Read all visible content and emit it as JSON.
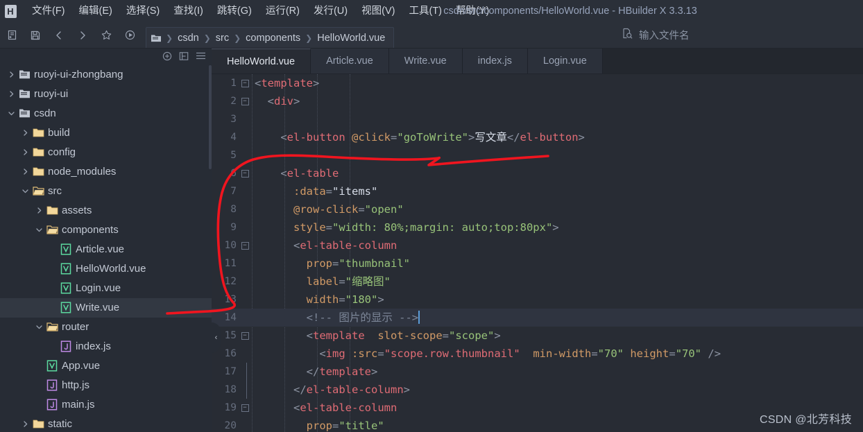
{
  "window": {
    "title": "csdn/src/components/HelloWorld.vue - HBuilder X 3.3.13",
    "logo_letter": "H"
  },
  "menubar": {
    "items": [
      {
        "label": "文件(F)",
        "name": "menu-file"
      },
      {
        "label": "编辑(E)",
        "name": "menu-edit"
      },
      {
        "label": "选择(S)",
        "name": "menu-select"
      },
      {
        "label": "查找(I)",
        "name": "menu-find"
      },
      {
        "label": "跳转(G)",
        "name": "menu-goto"
      },
      {
        "label": "运行(R)",
        "name": "menu-run"
      },
      {
        "label": "发行(U)",
        "name": "menu-publish"
      },
      {
        "label": "视图(V)",
        "name": "menu-view"
      },
      {
        "label": "工具(T)",
        "name": "menu-tools"
      },
      {
        "label": "帮助(Y)",
        "name": "menu-help"
      }
    ]
  },
  "toolbar": {
    "icons": [
      {
        "name": "new-file-icon"
      },
      {
        "name": "save-icon"
      },
      {
        "name": "back-arrow-icon"
      },
      {
        "name": "forward-arrow-icon"
      },
      {
        "name": "star-icon"
      },
      {
        "name": "run-icon"
      }
    ],
    "breadcrumb": [
      "csdn",
      "src",
      "components",
      "HelloWorld.vue"
    ],
    "file_search_placeholder": "输入文件名"
  },
  "sidebar": {
    "header_icons": [
      {
        "name": "add-project-icon"
      },
      {
        "name": "collapse-all-icon"
      },
      {
        "name": "menu-hamburger-icon"
      }
    ],
    "tree": [
      {
        "label": "ruoyi-ui-zhongbang",
        "indent": 0,
        "chev": "right",
        "icon": "project-icon",
        "selected": false
      },
      {
        "label": "ruoyi-ui",
        "indent": 0,
        "chev": "right",
        "icon": "project-icon",
        "selected": false
      },
      {
        "label": "csdn",
        "indent": 0,
        "chev": "down",
        "icon": "project-icon",
        "selected": false
      },
      {
        "label": "build",
        "indent": 1,
        "chev": "right",
        "icon": "folder-icon",
        "selected": false
      },
      {
        "label": "config",
        "indent": 1,
        "chev": "right",
        "icon": "folder-icon",
        "selected": false
      },
      {
        "label": "node_modules",
        "indent": 1,
        "chev": "right",
        "icon": "folder-icon",
        "selected": false
      },
      {
        "label": "src",
        "indent": 1,
        "chev": "down",
        "icon": "folder-open-icon",
        "selected": false
      },
      {
        "label": "assets",
        "indent": 2,
        "chev": "right",
        "icon": "folder-icon",
        "selected": false
      },
      {
        "label": "components",
        "indent": 2,
        "chev": "down",
        "icon": "folder-open-icon",
        "selected": false
      },
      {
        "label": "Article.vue",
        "indent": 3,
        "chev": "none",
        "icon": "vue-file-icon",
        "selected": false
      },
      {
        "label": "HelloWorld.vue",
        "indent": 3,
        "chev": "none",
        "icon": "vue-file-icon",
        "selected": false
      },
      {
        "label": "Login.vue",
        "indent": 3,
        "chev": "none",
        "icon": "vue-file-icon",
        "selected": false
      },
      {
        "label": "Write.vue",
        "indent": 3,
        "chev": "none",
        "icon": "vue-file-icon",
        "selected": true
      },
      {
        "label": "router",
        "indent": 2,
        "chev": "down",
        "icon": "folder-open-icon",
        "selected": false
      },
      {
        "label": "index.js",
        "indent": 3,
        "chev": "none",
        "icon": "js-file-icon",
        "selected": false
      },
      {
        "label": "App.vue",
        "indent": 2,
        "chev": "none",
        "icon": "vue-file-icon",
        "selected": false
      },
      {
        "label": "http.js",
        "indent": 2,
        "chev": "none",
        "icon": "js-file-icon",
        "selected": false
      },
      {
        "label": "main.js",
        "indent": 2,
        "chev": "none",
        "icon": "js-file-icon",
        "selected": false
      },
      {
        "label": "static",
        "indent": 1,
        "chev": "right",
        "icon": "folder-icon",
        "selected": false
      }
    ]
  },
  "editor": {
    "tabs": [
      {
        "label": "HelloWorld.vue",
        "active": true
      },
      {
        "label": "Article.vue",
        "active": false
      },
      {
        "label": "Write.vue",
        "active": false
      },
      {
        "label": "index.js",
        "active": false
      },
      {
        "label": "Login.vue",
        "active": false
      }
    ],
    "collapse_handle_glyph": "‹",
    "lines": [
      {
        "n": 1,
        "fold": "minus",
        "current": false,
        "tokens": [
          {
            "t": "brk",
            "v": "<"
          },
          {
            "t": "tag",
            "v": "template"
          },
          {
            "t": "brk",
            "v": ">"
          }
        ]
      },
      {
        "n": 2,
        "fold": "minus",
        "current": false,
        "tokens": [
          {
            "t": "txt",
            "v": "  "
          },
          {
            "t": "brk",
            "v": "<"
          },
          {
            "t": "tag",
            "v": "div"
          },
          {
            "t": "brk",
            "v": ">"
          }
        ]
      },
      {
        "n": 3,
        "fold": "none",
        "current": false,
        "tokens": []
      },
      {
        "n": 4,
        "fold": "none",
        "current": false,
        "tokens": [
          {
            "t": "txt",
            "v": "    "
          },
          {
            "t": "brk",
            "v": "<"
          },
          {
            "t": "tag",
            "v": "el-button"
          },
          {
            "t": "txt",
            "v": " "
          },
          {
            "t": "attr",
            "v": "@click"
          },
          {
            "t": "eq",
            "v": "="
          },
          {
            "t": "str",
            "v": "\"goToWrite\""
          },
          {
            "t": "brk",
            "v": ">"
          },
          {
            "t": "txt",
            "v": "写文章"
          },
          {
            "t": "brk",
            "v": "</"
          },
          {
            "t": "tag",
            "v": "el-button"
          },
          {
            "t": "brk",
            "v": ">"
          }
        ]
      },
      {
        "n": 5,
        "fold": "none",
        "current": false,
        "tokens": []
      },
      {
        "n": 6,
        "fold": "minus",
        "current": false,
        "tokens": [
          {
            "t": "txt",
            "v": "    "
          },
          {
            "t": "brk",
            "v": "<"
          },
          {
            "t": "tag",
            "v": "el-table"
          }
        ]
      },
      {
        "n": 7,
        "fold": "none",
        "current": false,
        "tokens": [
          {
            "t": "txt",
            "v": "      "
          },
          {
            "t": "attr",
            "v": ":data"
          },
          {
            "t": "eq",
            "v": "="
          },
          {
            "t": "txt",
            "v": "\"items\""
          }
        ]
      },
      {
        "n": 8,
        "fold": "none",
        "current": false,
        "tokens": [
          {
            "t": "txt",
            "v": "      "
          },
          {
            "t": "attr",
            "v": "@row-click"
          },
          {
            "t": "eq",
            "v": "="
          },
          {
            "t": "str",
            "v": "\"open\""
          }
        ]
      },
      {
        "n": 9,
        "fold": "none",
        "current": false,
        "tokens": [
          {
            "t": "txt",
            "v": "      "
          },
          {
            "t": "attr",
            "v": "style"
          },
          {
            "t": "eq",
            "v": "="
          },
          {
            "t": "str",
            "v": "\"width: 80%;margin: auto;top:80px\""
          },
          {
            "t": "brk",
            "v": ">"
          }
        ]
      },
      {
        "n": 10,
        "fold": "minus",
        "current": false,
        "tokens": [
          {
            "t": "txt",
            "v": "      "
          },
          {
            "t": "brk",
            "v": "<"
          },
          {
            "t": "tag",
            "v": "el-table-column"
          }
        ]
      },
      {
        "n": 11,
        "fold": "none",
        "current": false,
        "tokens": [
          {
            "t": "txt",
            "v": "        "
          },
          {
            "t": "attr",
            "v": "prop"
          },
          {
            "t": "eq",
            "v": "="
          },
          {
            "t": "str",
            "v": "\"thumbnail\""
          }
        ]
      },
      {
        "n": 12,
        "fold": "none",
        "current": false,
        "tokens": [
          {
            "t": "txt",
            "v": "        "
          },
          {
            "t": "attr",
            "v": "label"
          },
          {
            "t": "eq",
            "v": "="
          },
          {
            "t": "str",
            "v": "\"缩略图\""
          }
        ]
      },
      {
        "n": 13,
        "fold": "none",
        "current": false,
        "tokens": [
          {
            "t": "txt",
            "v": "        "
          },
          {
            "t": "attr",
            "v": "width"
          },
          {
            "t": "eq",
            "v": "="
          },
          {
            "t": "str",
            "v": "\"180\""
          },
          {
            "t": "brk",
            "v": ">"
          }
        ]
      },
      {
        "n": 14,
        "fold": "none",
        "current": true,
        "tokens": [
          {
            "t": "txt",
            "v": "        "
          },
          {
            "t": "cmt",
            "v": "<!-- 图片的显示 -->"
          }
        ]
      },
      {
        "n": 15,
        "fold": "minus",
        "current": false,
        "tokens": [
          {
            "t": "txt",
            "v": "        "
          },
          {
            "t": "brk",
            "v": "<"
          },
          {
            "t": "tag",
            "v": "template"
          },
          {
            "t": "txt",
            "v": "  "
          },
          {
            "t": "attr",
            "v": "slot-scope"
          },
          {
            "t": "eq",
            "v": "="
          },
          {
            "t": "str",
            "v": "\"scope\""
          },
          {
            "t": "brk",
            "v": ">"
          }
        ]
      },
      {
        "n": 16,
        "fold": "none",
        "current": false,
        "tokens": [
          {
            "t": "txt",
            "v": "          "
          },
          {
            "t": "brk",
            "v": "<"
          },
          {
            "t": "tag",
            "v": "img"
          },
          {
            "t": "txt",
            "v": " "
          },
          {
            "t": "attr",
            "v": ":src"
          },
          {
            "t": "eq",
            "v": "="
          },
          {
            "t": "tag",
            "v": "\"scope.row.thumbnail\""
          },
          {
            "t": "txt",
            "v": "  "
          },
          {
            "t": "attr",
            "v": "min-width"
          },
          {
            "t": "eq",
            "v": "="
          },
          {
            "t": "str",
            "v": "\"70\""
          },
          {
            "t": "txt",
            "v": " "
          },
          {
            "t": "attr",
            "v": "height"
          },
          {
            "t": "eq",
            "v": "="
          },
          {
            "t": "str",
            "v": "\"70\""
          },
          {
            "t": "txt",
            "v": " "
          },
          {
            "t": "brk",
            "v": "/>"
          }
        ]
      },
      {
        "n": 17,
        "fold": "end",
        "current": false,
        "tokens": [
          {
            "t": "txt",
            "v": "        "
          },
          {
            "t": "brk",
            "v": "</"
          },
          {
            "t": "tag",
            "v": "template"
          },
          {
            "t": "brk",
            "v": ">"
          }
        ]
      },
      {
        "n": 18,
        "fold": "end",
        "current": false,
        "tokens": [
          {
            "t": "txt",
            "v": "      "
          },
          {
            "t": "brk",
            "v": "</"
          },
          {
            "t": "tag",
            "v": "el-table-column"
          },
          {
            "t": "brk",
            "v": ">"
          }
        ]
      },
      {
        "n": 19,
        "fold": "minus",
        "current": false,
        "tokens": [
          {
            "t": "txt",
            "v": "      "
          },
          {
            "t": "brk",
            "v": "<"
          },
          {
            "t": "tag",
            "v": "el-table-column"
          }
        ]
      },
      {
        "n": 20,
        "fold": "none",
        "current": false,
        "tokens": [
          {
            "t": "txt",
            "v": "        "
          },
          {
            "t": "attr",
            "v": "prop"
          },
          {
            "t": "eq",
            "v": "="
          },
          {
            "t": "str",
            "v": "\"title\""
          }
        ]
      }
    ]
  },
  "annotation": {
    "color": "#f0151f",
    "name": "red-hand-drawn-curve"
  },
  "watermark": {
    "text": "CSDN @北芳科技"
  }
}
